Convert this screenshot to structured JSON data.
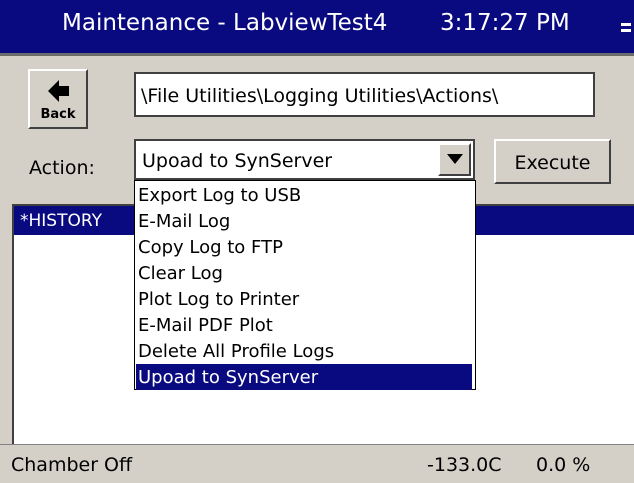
{
  "titlebar": {
    "title": "Maintenance - LabviewTest4",
    "time": "3:17:27 PM",
    "icon": "window-menu-icon"
  },
  "toolbar": {
    "back_label": "Back",
    "back_icon": "left-arrow-icon",
    "path": "\\File Utilities\\Logging Utilities\\Actions\\"
  },
  "action": {
    "label": "Action:",
    "selected": "Upoad to SynServer",
    "execute_label": "Execute",
    "options": [
      "Export Log to USB",
      "E-Mail Log",
      "Copy Log to FTP",
      "Clear Log",
      "Plot Log to Printer",
      "E-Mail PDF Plot",
      "Delete All Profile Logs",
      "Upoad to SynServer"
    ]
  },
  "list": {
    "header": "*HISTORY"
  },
  "status": {
    "chamber": "Chamber Off",
    "temperature": "-133.0C",
    "percent": "0.0 %"
  },
  "colors": {
    "titlebar_bg": "#0a0a80",
    "window_bg": "#d4d0c8",
    "selection_bg": "#0a0a80"
  }
}
